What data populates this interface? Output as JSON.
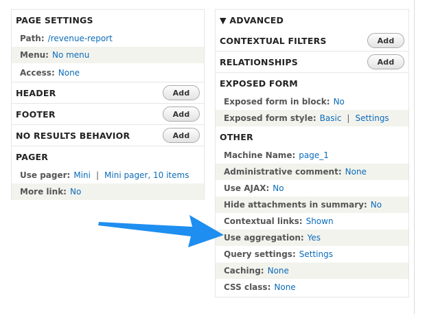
{
  "left": {
    "page_settings": {
      "title": "PAGE SETTINGS",
      "rows": [
        {
          "label": "Path:",
          "value": "/revenue-report"
        },
        {
          "label": "Menu:",
          "value": "No menu"
        },
        {
          "label": "Access:",
          "value": "None"
        }
      ]
    },
    "header": {
      "title": "HEADER",
      "button": "Add"
    },
    "footer": {
      "title": "FOOTER",
      "button": "Add"
    },
    "no_results": {
      "title": "NO RESULTS BEHAVIOR",
      "button": "Add"
    },
    "pager": {
      "title": "PAGER",
      "use_pager_label": "Use pager:",
      "use_pager_value": "Mini",
      "separator": "|",
      "use_pager_settings": "Mini pager, 10 items",
      "more_link_label": "More link:",
      "more_link_value": "No"
    }
  },
  "right": {
    "advanced": {
      "title": "▼ ADVANCED"
    },
    "contextual_filters": {
      "title": "CONTEXTUAL FILTERS",
      "button": "Add"
    },
    "relationships": {
      "title": "RELATIONSHIPS",
      "button": "Add"
    },
    "exposed_form": {
      "title": "EXPOSED FORM",
      "in_block_label": "Exposed form in block:",
      "in_block_value": "No",
      "style_label": "Exposed form style:",
      "style_value": "Basic",
      "separator": "|",
      "style_settings": "Settings"
    },
    "other": {
      "title": "OTHER",
      "rows": [
        {
          "label": "Machine Name:",
          "value": "page_1"
        },
        {
          "label": "Administrative comment:",
          "value": "None"
        },
        {
          "label": "Use AJAX:",
          "value": "No"
        },
        {
          "label": "Hide attachments in summary:",
          "value": "No"
        },
        {
          "label": "Contextual links:",
          "value": "Shown"
        },
        {
          "label": "Use aggregation:",
          "value": "Yes"
        },
        {
          "label": "Query settings:",
          "value": "Settings"
        },
        {
          "label": "Caching:",
          "value": "None"
        },
        {
          "label": "CSS class:",
          "value": "None"
        }
      ]
    }
  },
  "annotation": {
    "arrow_color": "#1e8ef0"
  }
}
